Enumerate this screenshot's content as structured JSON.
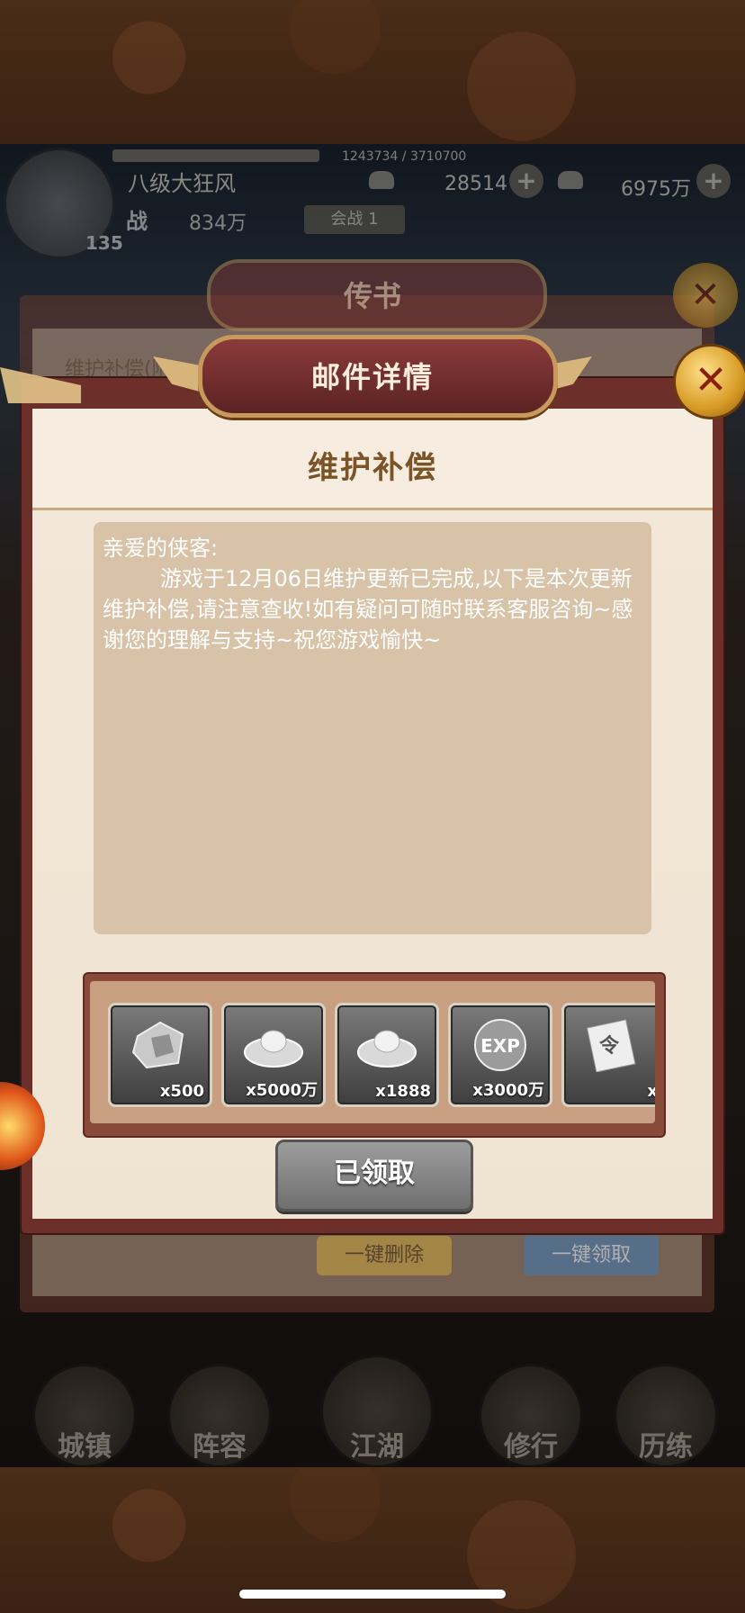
{
  "hud": {
    "player_name": "八级大狂风",
    "level": "135",
    "exp": "1243734 / 3710700",
    "power_icon": "战",
    "power": "834万",
    "badge": "会战 1",
    "currency1": "28514",
    "currency2": "6975万"
  },
  "back_dialog": {
    "title": "传书",
    "row_text": "维护补偿(附",
    "delete_all": "一键删除",
    "claim_all": "一键领取"
  },
  "nav": {
    "items": [
      "城镇",
      "阵容",
      "江湖",
      "修行",
      "历练"
    ]
  },
  "dialog": {
    "title": "邮件详情",
    "close_glyph": "✕",
    "subject": "维护补偿",
    "greeting": "亲爱的侠客:",
    "body": "游戏于12月06日维护更新已完成,以下是本次更新维护补偿,请注意查收!如有疑问可随时联系客服咨询~感谢您的理解与支持~祝您游戏愉快~",
    "rewards": [
      {
        "icon": "stone-icon",
        "qty": "x500"
      },
      {
        "icon": "silver-ingot-icon",
        "qty": "x5000万"
      },
      {
        "icon": "silver-ingot-icon",
        "qty": "x1888"
      },
      {
        "icon": "exp-orb-icon",
        "qty": "x3000万"
      },
      {
        "icon": "scroll-icon",
        "qty": "x"
      }
    ],
    "claimed_label": "已领取"
  }
}
